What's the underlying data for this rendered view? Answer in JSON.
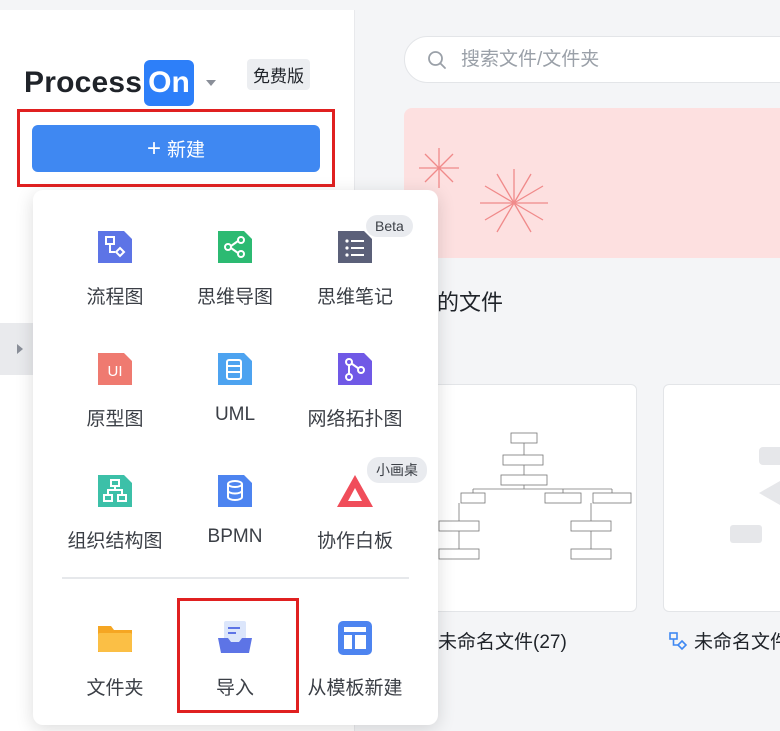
{
  "brand": {
    "name": "Process",
    "suffix": "On",
    "plan_badge": "免费版"
  },
  "new_button": {
    "icon": "plus-icon",
    "label": "新建"
  },
  "search": {
    "placeholder": "搜索文件/文件夹"
  },
  "main": {
    "section_title": "的文件",
    "section_sub": "",
    "files": [
      {
        "name": "未命名文件(27)"
      },
      {
        "name": "未命名文件"
      }
    ]
  },
  "menu": {
    "items": [
      {
        "label": "流程图",
        "icon": "flowchart-icon"
      },
      {
        "label": "思维导图",
        "icon": "mindmap-icon"
      },
      {
        "label": "思维笔记",
        "icon": "mind-notes-icon",
        "tag": "Beta"
      },
      {
        "label": "原型图",
        "icon": "ui-prototype-icon"
      },
      {
        "label": "UML",
        "icon": "uml-icon"
      },
      {
        "label": "网络拓扑图",
        "icon": "network-topology-icon"
      },
      {
        "label": "组织结构图",
        "icon": "org-chart-icon"
      },
      {
        "label": "BPMN",
        "icon": "bpmn-icon"
      },
      {
        "label": "协作白板",
        "icon": "whiteboard-icon",
        "tag": "小画桌"
      }
    ],
    "actions": [
      {
        "label": "文件夹",
        "icon": "folder-icon"
      },
      {
        "label": "导入",
        "icon": "import-icon"
      },
      {
        "label": "从模板新建",
        "icon": "template-icon"
      }
    ]
  },
  "colors": {
    "primary": "#3f88f2",
    "highlight": "#e02020",
    "banner": "#fde0e0"
  }
}
